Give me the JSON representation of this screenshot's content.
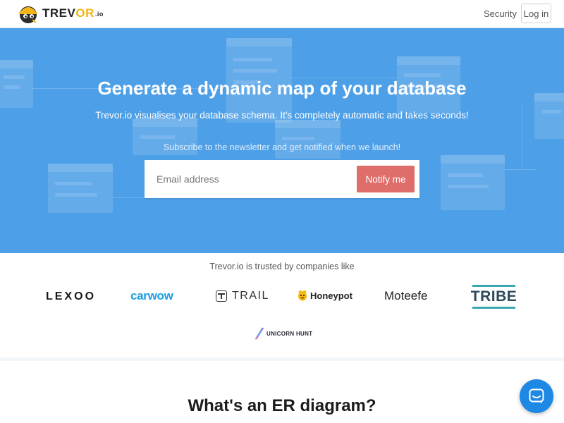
{
  "header": {
    "logo": {
      "name_main": "TREV",
      "name_accent": "OR",
      "suffix": ".io",
      "icon": "hardhat-mascot-icon"
    },
    "nav": {
      "security": "Security",
      "login": "Log in"
    }
  },
  "hero": {
    "title": "Generate a dynamic map of your database",
    "subtitle": "Trevor.io visualises your database schema. It's completely automatic and takes seconds!",
    "newsletter_note": "Subscribe to the newsletter and get notified when we launch!",
    "email_placeholder": "Email address",
    "notify_label": "Notify me"
  },
  "trusted": {
    "title": "Trevor.io is trusted by companies like",
    "brands": [
      "LEXOO",
      "carwow",
      "TRAIL",
      "Honeypot",
      "Moteefe",
      "TRIBE",
      "UNICORN HUNT"
    ]
  },
  "section": {
    "title": "What's an ER diagram?"
  },
  "colors": {
    "hero_bg": "#4d9fe7",
    "notify_button": "#df6e6b",
    "logo_accent": "#f2b417",
    "chat_launcher": "#1e88e5"
  },
  "chat": {
    "icon": "chat-bubble-icon"
  }
}
